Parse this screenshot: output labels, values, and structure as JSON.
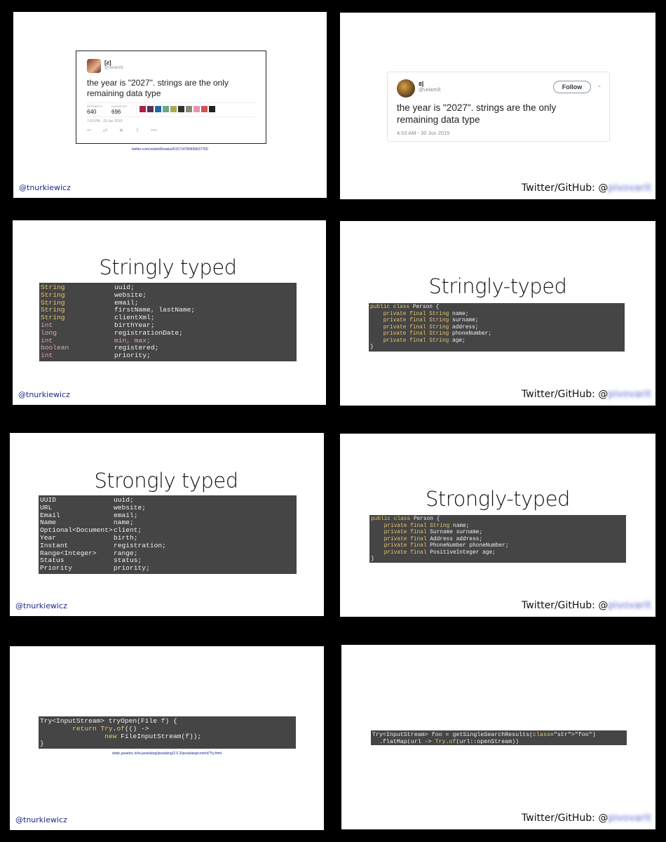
{
  "footers": {
    "left_handle": "@tnurkiewicz",
    "right_label": "Twitter/GitHub: @",
    "right_handle_blurred": "pivovarit"
  },
  "slide1": {
    "tweet": {
      "display_name": "[ꙅ]",
      "handle": "@velartrill",
      "text": "the year is \"2027\". strings are the only remaining data type",
      "retweets_label": "RETWEETS",
      "retweets": "640",
      "favorites_label": "FAVORITES",
      "favorites": "696",
      "timestamp": "7:53 PM - 29 Jun 2015"
    },
    "link": "twitter.com/velartrill/status/615714789499637760"
  },
  "slide2": {
    "tweet": {
      "display_name": "ꙅ|",
      "handle": "@velartrill",
      "follow": "Follow",
      "text": "the year is \"2027\". strings are the only remaining data type",
      "timestamp": "4:53 AM - 30 Jun 2015"
    }
  },
  "slide3": {
    "title": "Stringly typed",
    "rows": [
      {
        "type": "String",
        "field": "uuid;"
      },
      {
        "type": "String",
        "field": "website;"
      },
      {
        "type": "String",
        "field": "email;"
      },
      {
        "type": "String",
        "field": "firstName, lastName;"
      },
      {
        "type": "String",
        "field": "clientXml;"
      },
      {
        "type": "int",
        "field": "birthYear;"
      },
      {
        "type": "long",
        "field": "registrationDate;"
      },
      {
        "type": "int",
        "field": "min, max;"
      },
      {
        "type": "boolean",
        "field": "registered;"
      },
      {
        "type": "int",
        "field": "priority;"
      }
    ]
  },
  "slide4": {
    "title": "Stringly-typed",
    "lines": [
      "public class Person {",
      "    private final String name;",
      "    private final String surname;",
      "    private final String address;",
      "    private final String phoneNumber;",
      "    private final String age;",
      "}"
    ]
  },
  "slide5": {
    "title": "Strongly typed",
    "rows": [
      {
        "type": "UUID",
        "field": "uuid;"
      },
      {
        "type": "URL",
        "field": "website;"
      },
      {
        "type": "Email",
        "field": "email;"
      },
      {
        "type": "Name",
        "field": "name;"
      },
      {
        "type": "Optional<Document>",
        "field": "client;"
      },
      {
        "type": "Year",
        "field": "birth;"
      },
      {
        "type": "Instant",
        "field": "registration;"
      },
      {
        "type": "Range<Integer>",
        "field": "range;"
      },
      {
        "type": "Status",
        "field": "status;"
      },
      {
        "type": "Priority",
        "field": "priority;"
      }
    ]
  },
  "slide6": {
    "title": "Strongly-typed",
    "lines": [
      "public class Person {",
      "    private final String name;",
      "    private final Surname surname;",
      "    private final Address address;",
      "    private final PhoneNumber phoneNumber;",
      "    private final PositiveInteger age;",
      "}"
    ]
  },
  "slide7": {
    "lines": [
      "Try<InputStream> tryOpen(File f) {",
      "        return Try.of(() ->",
      "                new FileInputStream(f));",
      "}"
    ],
    "link": "static.javadoc.io/io.javaslang/javaslang/2.0.2/javaslang/control/Try.html"
  },
  "slide8": {
    "lines": [
      "Try<InputStream> foo = getSingleSearchResults(\"foo\")",
      "  .flatMap(url -> Try.of(url::openStream))"
    ]
  },
  "colors": {
    "code_bg": "#454545",
    "keyword": "#e9c46a",
    "primitive": "#e3a4a4",
    "handle": "#1b2a8a"
  }
}
